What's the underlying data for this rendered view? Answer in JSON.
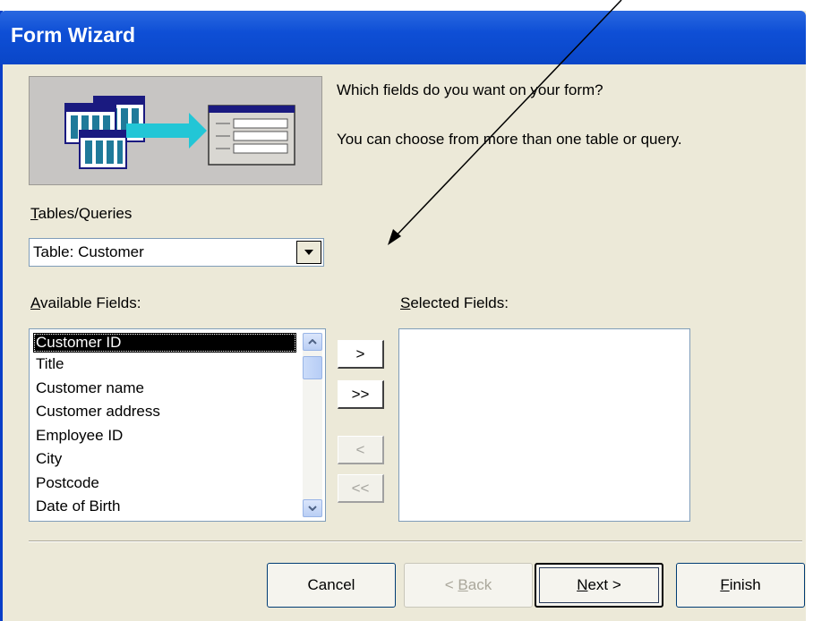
{
  "window": {
    "title": "Form Wizard"
  },
  "prompt": {
    "question": "Which fields do you want on your form?",
    "hint": "You can choose from more than one table or query."
  },
  "tables_queries": {
    "label_underline": "T",
    "label_rest": "ables/Queries",
    "value": "Table: Customer"
  },
  "available_fields": {
    "label_underline": "A",
    "label_rest": "vailable Fields:",
    "items": [
      "Customer ID",
      "Title",
      "Customer name",
      "Customer address",
      "Employee ID",
      "City",
      "Postcode",
      "Date of Birth"
    ]
  },
  "selected_fields": {
    "label_underline": "S",
    "label_rest": "elected Fields:"
  },
  "move_buttons": {
    "add_one": ">",
    "add_all": ">>",
    "remove_one": "<",
    "remove_all": "<<"
  },
  "buttons": {
    "cancel": "Cancel",
    "back_prefix": "< ",
    "back_underline": "B",
    "back_rest": "ack",
    "next_underline": "N",
    "next_rest": "ext >",
    "finish_underline": "F",
    "finish_rest": "inish"
  },
  "icons": {
    "dropdown": "chevron-down-icon",
    "scroll_up": "scroll-up-icon",
    "scroll_down": "scroll-down-icon",
    "wizard_banner": "form-wizard-illustration"
  },
  "colors": {
    "title_bar": "#0e4fd6",
    "dialog_bg": "#ece9d8",
    "selection": "#000000",
    "annotation_arrow": "#000000"
  }
}
